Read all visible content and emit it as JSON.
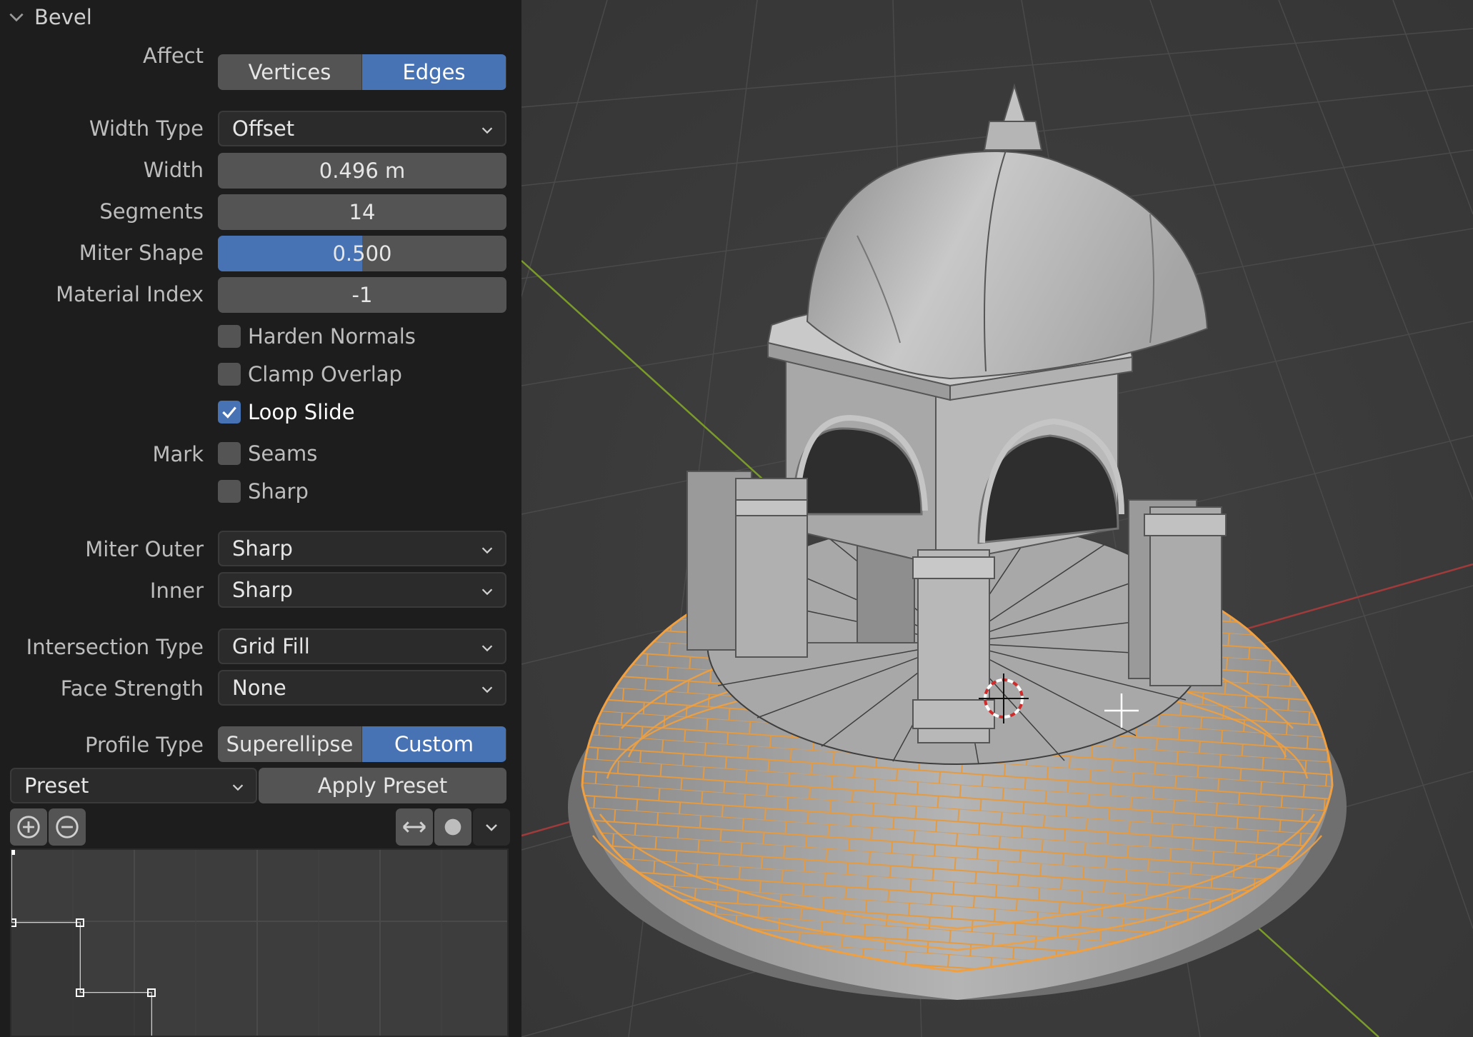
{
  "panel": {
    "title": "Bevel",
    "affect": {
      "label": "Affect",
      "options": [
        "Vertices",
        "Edges"
      ],
      "selected": "Edges"
    },
    "width_type": {
      "label": "Width Type",
      "value": "Offset"
    },
    "width": {
      "label": "Width",
      "value": "0.496 m"
    },
    "segments": {
      "label": "Segments",
      "value": "14"
    },
    "miter_shape": {
      "label": "Miter Shape",
      "value": "0.500",
      "fraction": 0.5
    },
    "material_index": {
      "label": "Material Index",
      "value": "-1"
    },
    "harden_normals": {
      "label": "Harden Normals",
      "checked": false
    },
    "clamp_overlap": {
      "label": "Clamp Overlap",
      "checked": false
    },
    "loop_slide": {
      "label": "Loop Slide",
      "checked": true
    },
    "mark": {
      "label": "Mark"
    },
    "mark_seams": {
      "label": "Seams",
      "checked": false
    },
    "mark_sharp": {
      "label": "Sharp",
      "checked": false
    },
    "miter_outer": {
      "label": "Miter Outer",
      "value": "Sharp"
    },
    "inner": {
      "label": "Inner",
      "value": "Sharp"
    },
    "intersection_type": {
      "label": "Intersection Type",
      "value": "Grid Fill"
    },
    "face_strength": {
      "label": "Face Strength",
      "value": "None"
    },
    "profile_type": {
      "label": "Profile Type",
      "options": [
        "Superellipse",
        "Custom"
      ],
      "selected": "Custom"
    },
    "preset": {
      "value": "Preset"
    },
    "apply_preset": {
      "label": "Apply Preset"
    }
  },
  "icons": [
    "chevron-down-icon",
    "zoom-in-icon",
    "zoom-out-icon",
    "flip-icon",
    "dot-icon",
    "checkmark-icon",
    "3d-cursor-icon",
    "crosshair-icon"
  ],
  "colors": {
    "accent": "#4772b3",
    "panel_bg": "#1d1d1d",
    "viewport_bg": "#3a3a3a",
    "selection": "#f0a040",
    "x_axis": "#9b3a3a",
    "y_axis": "#6b8a2a"
  }
}
